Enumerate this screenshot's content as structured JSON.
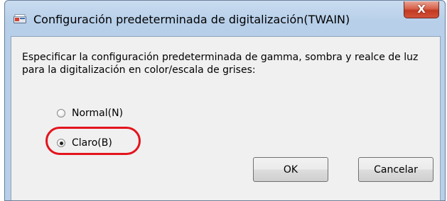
{
  "window": {
    "title": "Configuración predeterminada de digitalización(TWAIN)",
    "icon": "scanner-app-icon",
    "close_label": "X"
  },
  "dialog": {
    "description": "Especificar la configuración predeterminada de gamma, sombra y realce de luz para la digitalización en color/escala de grises:",
    "options": [
      {
        "label": "Normal(N)",
        "checked": false
      },
      {
        "label": "Claro(B)",
        "checked": true
      }
    ],
    "highlight_color": "#e3141d"
  },
  "buttons": {
    "ok_label": "OK",
    "cancel_label": "Cancelar"
  }
}
